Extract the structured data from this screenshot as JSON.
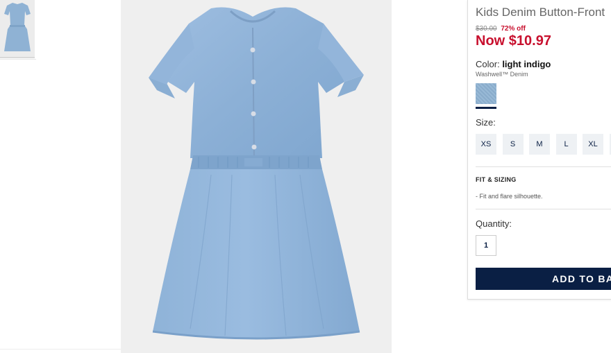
{
  "product": {
    "title": "Kids Denim Button-Front",
    "original_price": "$30.00",
    "discount": "72% off",
    "now_price": "Now $10.97"
  },
  "color": {
    "label": "Color:",
    "value": "light indigo",
    "material": "Washwell™ Denim",
    "swatch_color": "#8fb3d3"
  },
  "size": {
    "label": "Size:",
    "options": [
      "XS",
      "S",
      "M",
      "L",
      "XL"
    ]
  },
  "fit": {
    "heading": "FIT & SIZING",
    "bullets": [
      "- Fit and flare silhouette."
    ]
  },
  "quantity": {
    "label": "Quantity:",
    "value": "1"
  },
  "cta": {
    "add_to_bag": "ADD TO BAG"
  },
  "colors": {
    "accent_navy": "#0a1f44",
    "sale_red": "#c8102e",
    "denim": "#8fb3d3"
  }
}
